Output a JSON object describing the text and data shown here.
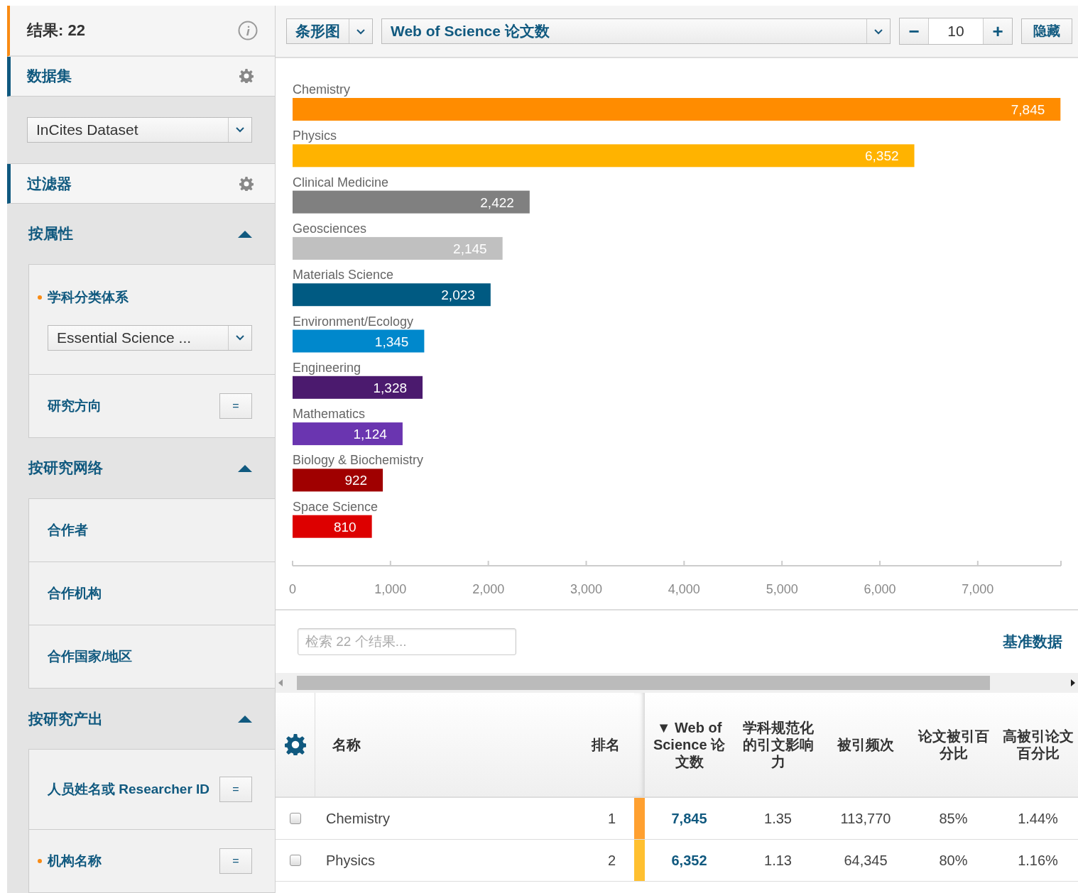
{
  "results_header": {
    "label": "结果: 22"
  },
  "dataset_section": {
    "title": "数据集",
    "dropdown": "InCites Dataset"
  },
  "filter_section": {
    "title": "过滤器"
  },
  "filter_groups": [
    {
      "title": "按属性",
      "expanded": true,
      "items": [
        {
          "kind": "dropdown",
          "label": "学科分类体系",
          "required": true,
          "value": "Essential Science ..."
        },
        {
          "kind": "button",
          "label": "研究方向",
          "required": false,
          "button": "="
        }
      ]
    },
    {
      "title": "按研究网络",
      "expanded": true,
      "items": [
        {
          "kind": "plain",
          "label": "合作者",
          "required": false
        },
        {
          "kind": "plain",
          "label": "合作机构",
          "required": false
        },
        {
          "kind": "plain",
          "label": "合作国家/地区",
          "required": false
        }
      ]
    },
    {
      "title": "按研究产出",
      "expanded": true,
      "items": [
        {
          "kind": "button",
          "label": "人员姓名或 Researcher ID",
          "required": false,
          "button": "="
        },
        {
          "kind": "button",
          "label": "机构名称",
          "required": true,
          "button": "="
        }
      ]
    }
  ],
  "toolbar": {
    "chart_type": "条形图",
    "metric": "Web of Science 论文数",
    "minus": "−",
    "count": "10",
    "plus": "+",
    "hide": "隐藏"
  },
  "chart_data": {
    "type": "bar",
    "orientation": "horizontal",
    "data_labels": true,
    "categories": [
      "Chemistry",
      "Physics",
      "Clinical Medicine",
      "Geosciences",
      "Materials Science",
      "Environment/Ecology",
      "Engineering",
      "Mathematics",
      "Biology & Biochemistry",
      "Space Science"
    ],
    "values": [
      7845,
      6352,
      2422,
      2145,
      2023,
      1345,
      1328,
      1124,
      922,
      810
    ],
    "value_labels": [
      "7,845",
      "6,352",
      "2,422",
      "2,145",
      "2,023",
      "1,345",
      "1,328",
      "1,124",
      "922",
      "810"
    ],
    "colors": [
      "#ff8c00",
      "#ffb300",
      "#808080",
      "#c0c0c0",
      "#005a82",
      "#0088cc",
      "#4b1a6e",
      "#6a35b0",
      "#a00000",
      "#dd0000"
    ],
    "xlim": [
      0,
      7850
    ],
    "xticks": [
      {
        "value": 0,
        "label": "0"
      },
      {
        "value": 1000,
        "label": "1,000"
      },
      {
        "value": 2000,
        "label": "2,000"
      },
      {
        "value": 3000,
        "label": "3,000"
      },
      {
        "value": 4000,
        "label": "4,000"
      },
      {
        "value": 5000,
        "label": "5,000"
      },
      {
        "value": 6000,
        "label": "6,000"
      },
      {
        "value": 7000,
        "label": "7,000"
      }
    ]
  },
  "search": {
    "placeholder": "检索 22 个结果..."
  },
  "benchmark_link": "基准数据",
  "table": {
    "columns": [
      {
        "label": "名称"
      },
      {
        "label": "排名"
      },
      {
        "label": "Web of Science 论文数",
        "sort_indicator": "▼"
      },
      {
        "label": "学科规范化的引文影响力"
      },
      {
        "label": "被引频次"
      },
      {
        "label": "论文被引百分比"
      },
      {
        "label": "高被引论文百分比"
      }
    ],
    "rows": [
      {
        "checked": false,
        "color": "#ffa030",
        "cells": [
          "Chemistry",
          "1",
          "7,845",
          "1.35",
          "113,770",
          "85%",
          "1.44%"
        ]
      },
      {
        "checked": false,
        "color": "#ffc030",
        "cells": [
          "Physics",
          "2",
          "6,352",
          "1.13",
          "64,345",
          "80%",
          "1.16%"
        ]
      }
    ]
  }
}
